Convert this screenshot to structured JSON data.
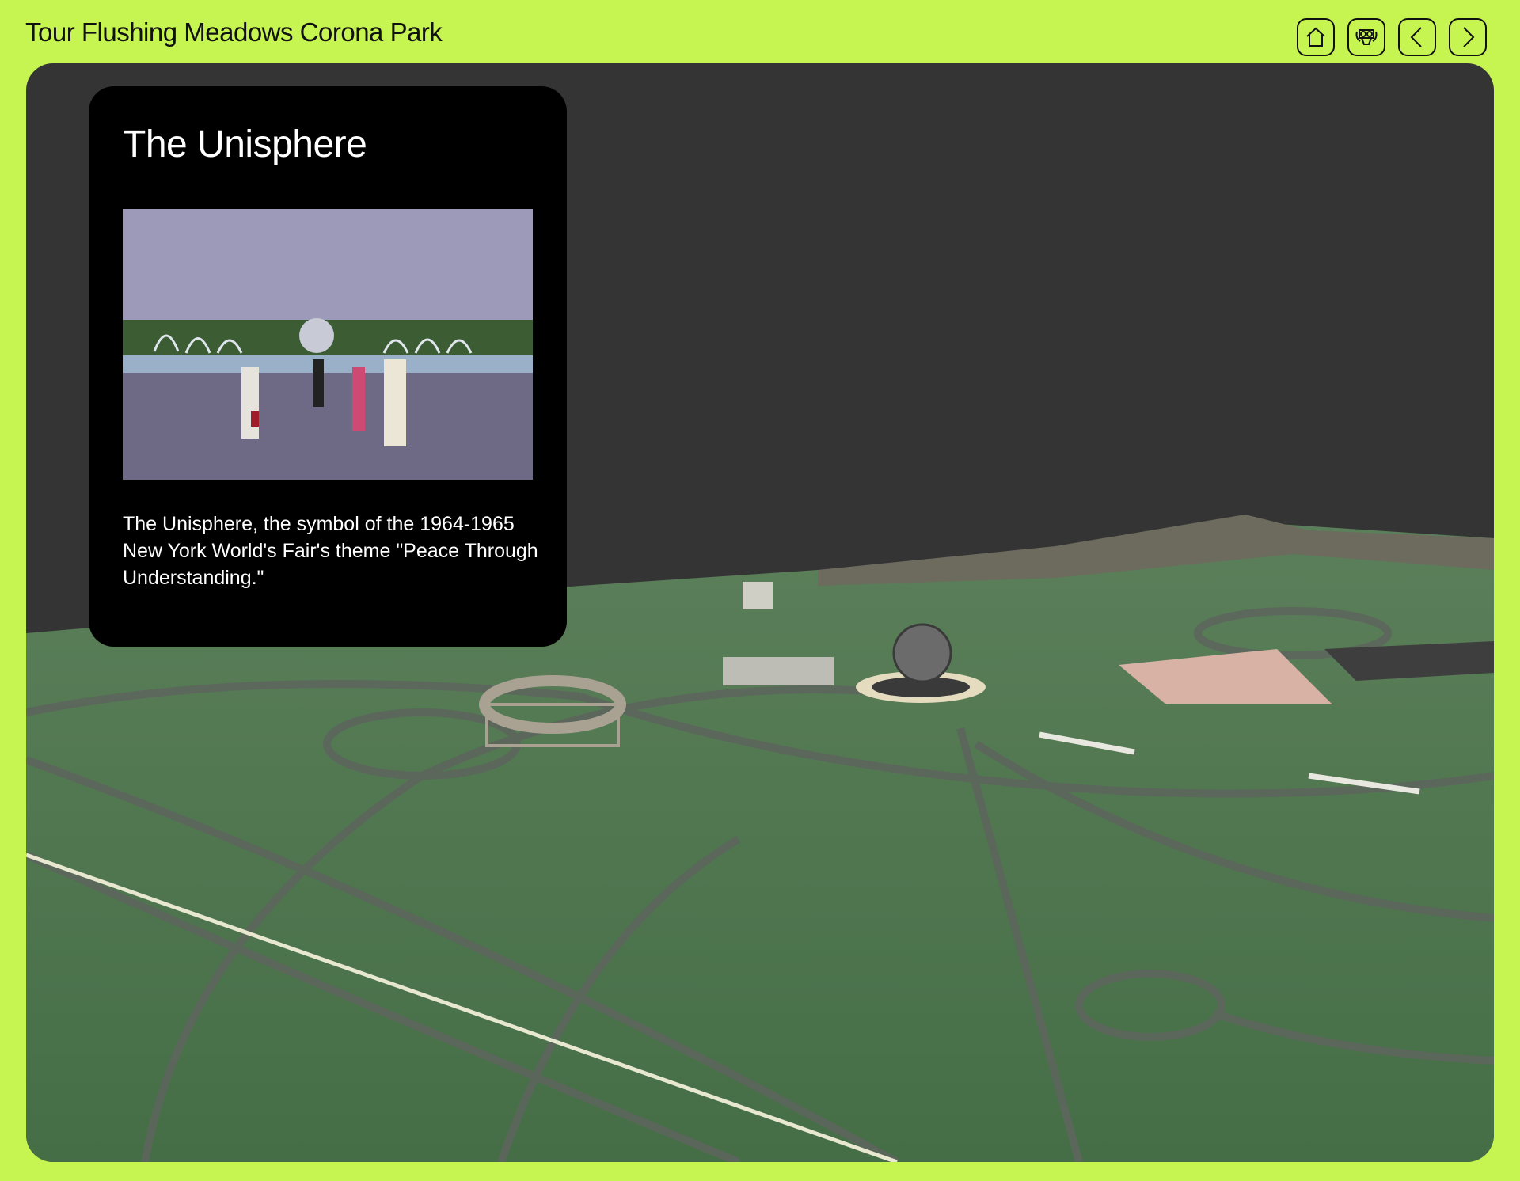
{
  "header": {
    "title": "Tour Flushing Meadows Corona Park",
    "nav": [
      {
        "name": "home",
        "icon": "home-icon"
      },
      {
        "name": "viewer",
        "icon": "binoculars-viewer-icon"
      },
      {
        "name": "previous",
        "icon": "chevron-left-icon"
      },
      {
        "name": "next",
        "icon": "chevron-right-icon"
      }
    ]
  },
  "info_card": {
    "title": "The Unisphere",
    "photo_icon": "historical-photo-unisphere",
    "description": "The Unisphere, the symbol of the 1964-1965 New York World's Fair's theme \"Peace Through Understanding.\""
  },
  "scene": {
    "description_icon": "3d-park-model-map"
  },
  "colors": {
    "accent": "#c6f552",
    "viewer_bg": "#343434",
    "card_bg": "#000000",
    "grass": "#4e7a4d"
  }
}
